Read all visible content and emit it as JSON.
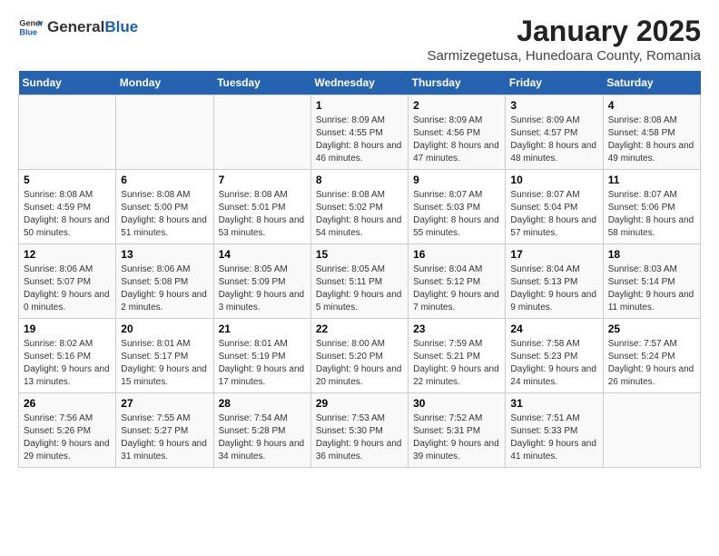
{
  "header": {
    "logo_general": "General",
    "logo_blue": "Blue",
    "title": "January 2025",
    "subtitle": "Sarmizegetusa, Hunedoara County, Romania"
  },
  "weekdays": [
    "Sunday",
    "Monday",
    "Tuesday",
    "Wednesday",
    "Thursday",
    "Friday",
    "Saturday"
  ],
  "weeks": [
    [
      {
        "day": "",
        "info": ""
      },
      {
        "day": "",
        "info": ""
      },
      {
        "day": "",
        "info": ""
      },
      {
        "day": "1",
        "info": "Sunrise: 8:09 AM\nSunset: 4:55 PM\nDaylight: 8 hours and 46 minutes."
      },
      {
        "day": "2",
        "info": "Sunrise: 8:09 AM\nSunset: 4:56 PM\nDaylight: 8 hours and 47 minutes."
      },
      {
        "day": "3",
        "info": "Sunrise: 8:09 AM\nSunset: 4:57 PM\nDaylight: 8 hours and 48 minutes."
      },
      {
        "day": "4",
        "info": "Sunrise: 8:08 AM\nSunset: 4:58 PM\nDaylight: 8 hours and 49 minutes."
      }
    ],
    [
      {
        "day": "5",
        "info": "Sunrise: 8:08 AM\nSunset: 4:59 PM\nDaylight: 8 hours and 50 minutes."
      },
      {
        "day": "6",
        "info": "Sunrise: 8:08 AM\nSunset: 5:00 PM\nDaylight: 8 hours and 51 minutes."
      },
      {
        "day": "7",
        "info": "Sunrise: 8:08 AM\nSunset: 5:01 PM\nDaylight: 8 hours and 53 minutes."
      },
      {
        "day": "8",
        "info": "Sunrise: 8:08 AM\nSunset: 5:02 PM\nDaylight: 8 hours and 54 minutes."
      },
      {
        "day": "9",
        "info": "Sunrise: 8:07 AM\nSunset: 5:03 PM\nDaylight: 8 hours and 55 minutes."
      },
      {
        "day": "10",
        "info": "Sunrise: 8:07 AM\nSunset: 5:04 PM\nDaylight: 8 hours and 57 minutes."
      },
      {
        "day": "11",
        "info": "Sunrise: 8:07 AM\nSunset: 5:06 PM\nDaylight: 8 hours and 58 minutes."
      }
    ],
    [
      {
        "day": "12",
        "info": "Sunrise: 8:06 AM\nSunset: 5:07 PM\nDaylight: 9 hours and 0 minutes."
      },
      {
        "day": "13",
        "info": "Sunrise: 8:06 AM\nSunset: 5:08 PM\nDaylight: 9 hours and 2 minutes."
      },
      {
        "day": "14",
        "info": "Sunrise: 8:05 AM\nSunset: 5:09 PM\nDaylight: 9 hours and 3 minutes."
      },
      {
        "day": "15",
        "info": "Sunrise: 8:05 AM\nSunset: 5:11 PM\nDaylight: 9 hours and 5 minutes."
      },
      {
        "day": "16",
        "info": "Sunrise: 8:04 AM\nSunset: 5:12 PM\nDaylight: 9 hours and 7 minutes."
      },
      {
        "day": "17",
        "info": "Sunrise: 8:04 AM\nSunset: 5:13 PM\nDaylight: 9 hours and 9 minutes."
      },
      {
        "day": "18",
        "info": "Sunrise: 8:03 AM\nSunset: 5:14 PM\nDaylight: 9 hours and 11 minutes."
      }
    ],
    [
      {
        "day": "19",
        "info": "Sunrise: 8:02 AM\nSunset: 5:16 PM\nDaylight: 9 hours and 13 minutes."
      },
      {
        "day": "20",
        "info": "Sunrise: 8:01 AM\nSunset: 5:17 PM\nDaylight: 9 hours and 15 minutes."
      },
      {
        "day": "21",
        "info": "Sunrise: 8:01 AM\nSunset: 5:19 PM\nDaylight: 9 hours and 17 minutes."
      },
      {
        "day": "22",
        "info": "Sunrise: 8:00 AM\nSunset: 5:20 PM\nDaylight: 9 hours and 20 minutes."
      },
      {
        "day": "23",
        "info": "Sunrise: 7:59 AM\nSunset: 5:21 PM\nDaylight: 9 hours and 22 minutes."
      },
      {
        "day": "24",
        "info": "Sunrise: 7:58 AM\nSunset: 5:23 PM\nDaylight: 9 hours and 24 minutes."
      },
      {
        "day": "25",
        "info": "Sunrise: 7:57 AM\nSunset: 5:24 PM\nDaylight: 9 hours and 26 minutes."
      }
    ],
    [
      {
        "day": "26",
        "info": "Sunrise: 7:56 AM\nSunset: 5:26 PM\nDaylight: 9 hours and 29 minutes."
      },
      {
        "day": "27",
        "info": "Sunrise: 7:55 AM\nSunset: 5:27 PM\nDaylight: 9 hours and 31 minutes."
      },
      {
        "day": "28",
        "info": "Sunrise: 7:54 AM\nSunset: 5:28 PM\nDaylight: 9 hours and 34 minutes."
      },
      {
        "day": "29",
        "info": "Sunrise: 7:53 AM\nSunset: 5:30 PM\nDaylight: 9 hours and 36 minutes."
      },
      {
        "day": "30",
        "info": "Sunrise: 7:52 AM\nSunset: 5:31 PM\nDaylight: 9 hours and 39 minutes."
      },
      {
        "day": "31",
        "info": "Sunrise: 7:51 AM\nSunset: 5:33 PM\nDaylight: 9 hours and 41 minutes."
      },
      {
        "day": "",
        "info": ""
      }
    ]
  ]
}
